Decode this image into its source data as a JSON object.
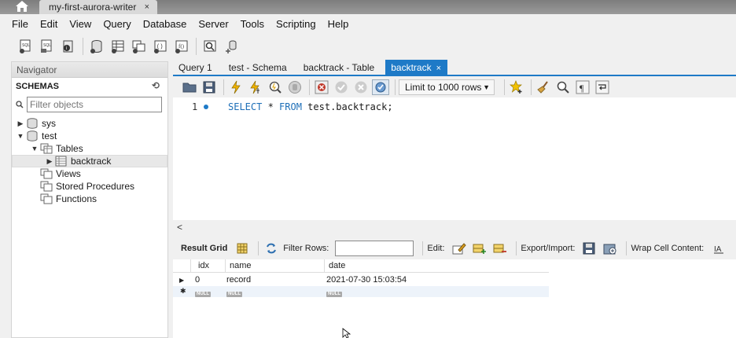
{
  "titlebar": {
    "connection_tab": "my-first-aurora-writer",
    "close": "×"
  },
  "menu": [
    "File",
    "Edit",
    "View",
    "Query",
    "Database",
    "Server",
    "Tools",
    "Scripting",
    "Help"
  ],
  "navigator": {
    "title": "Navigator",
    "schemas_label": "SCHEMAS",
    "filter_placeholder": "Filter objects",
    "tree": {
      "sys": "sys",
      "test": "test",
      "tables": "Tables",
      "backtrack": "backtrack",
      "views": "Views",
      "stored_procedures": "Stored Procedures",
      "functions": "Functions"
    }
  },
  "tabs": [
    {
      "label": "Query 1",
      "active": false
    },
    {
      "label": "test - Schema",
      "active": false
    },
    {
      "label": "backtrack - Table",
      "active": false
    },
    {
      "label": "backtrack",
      "active": true
    }
  ],
  "tab_close": "×",
  "editor_toolbar": {
    "limit": "Limit to 1000 rows"
  },
  "editor": {
    "line_number": "1",
    "sql_keyword_1": "SELECT",
    "sql_mid": " * ",
    "sql_keyword_2": "FROM",
    "sql_tail": " test.backtrack;"
  },
  "result_toolbar": {
    "result_grid": "Result Grid",
    "filter_rows": "Filter Rows:",
    "edit": "Edit:",
    "export_import": "Export/Import:",
    "wrap_cell": "Wrap Cell Content:"
  },
  "grid": {
    "columns": [
      "idx",
      "name",
      "date"
    ],
    "rows": [
      [
        "0",
        "record",
        "2021-07-30 15:03:54"
      ]
    ],
    "null_label": "NULL"
  },
  "colors": {
    "accent": "#1e7ac7",
    "keyword": "#1e6fb8"
  }
}
